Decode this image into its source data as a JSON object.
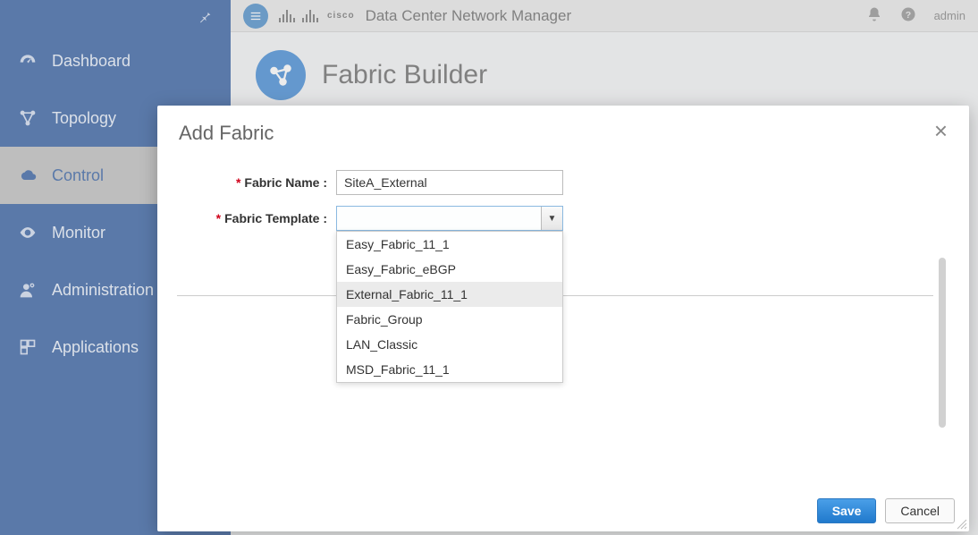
{
  "topbar": {
    "brand_small": "cisco",
    "title": "Data Center Network Manager",
    "user_label": "admin"
  },
  "sidebar": {
    "items": [
      {
        "label": "Dashboard"
      },
      {
        "label": "Topology"
      },
      {
        "label": "Control"
      },
      {
        "label": "Monitor"
      },
      {
        "label": "Administration"
      },
      {
        "label": "Applications"
      }
    ]
  },
  "content": {
    "page_title": "Fabric Builder"
  },
  "modal": {
    "title": "Add Fabric",
    "labels": {
      "fabric_name": "Fabric Name :",
      "fabric_template": "Fabric Template :"
    },
    "values": {
      "fabric_name": "SiteA_External",
      "fabric_template": ""
    },
    "template_options": [
      "Easy_Fabric_11_1",
      "Easy_Fabric_eBGP",
      "External_Fabric_11_1",
      "Fabric_Group",
      "LAN_Classic",
      "MSD_Fabric_11_1"
    ],
    "highlighted_option_index": 2,
    "buttons": {
      "save": "Save",
      "cancel": "Cancel"
    }
  }
}
